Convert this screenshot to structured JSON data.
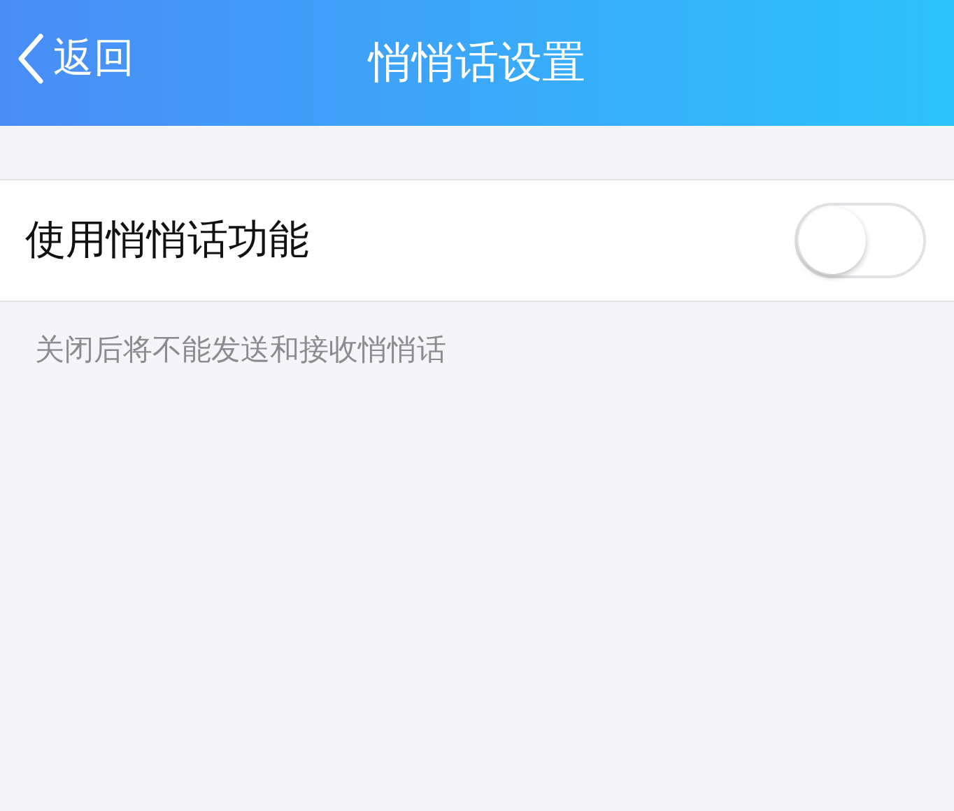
{
  "nav": {
    "back_label": "返回",
    "title": "悄悄话设置"
  },
  "settings": [
    {
      "label": "使用悄悄话功能",
      "on": false
    }
  ],
  "hint": "关闭后将不能发送和接收悄悄话"
}
